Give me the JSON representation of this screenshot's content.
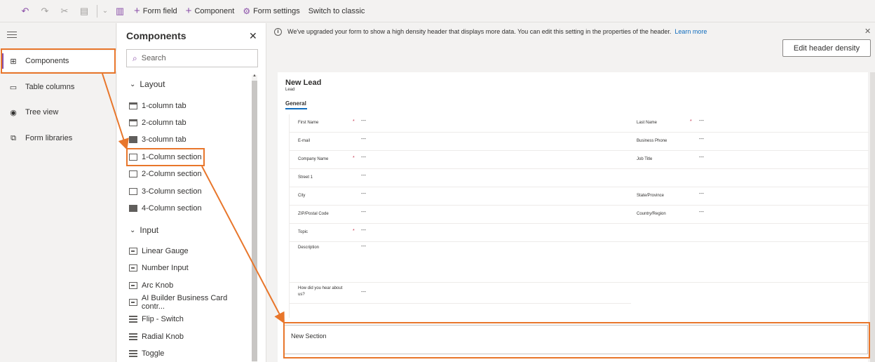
{
  "toolbar": {
    "undo_icon": "undo-icon",
    "redo_icon": "redo-icon",
    "cut_icon": "cut-icon",
    "paste_icon": "paste-icon",
    "delete_icon": "delete-icon",
    "form_field": "Form field",
    "component": "Component",
    "form_settings": "Form settings",
    "switch_classic": "Switch to classic"
  },
  "leftnav": {
    "items": [
      {
        "label": "Components",
        "icon": "components-icon"
      },
      {
        "label": "Table columns",
        "icon": "table-columns-icon"
      },
      {
        "label": "Tree view",
        "icon": "tree-view-icon"
      },
      {
        "label": "Form libraries",
        "icon": "form-libraries-icon"
      }
    ]
  },
  "components_panel": {
    "title": "Components",
    "search_placeholder": "Search",
    "groups": [
      {
        "name": "Layout",
        "items": [
          "1-column tab",
          "2-column tab",
          "3-column tab",
          "1-Column section",
          "2-Column section",
          "3-Column section",
          "4-Column section"
        ]
      },
      {
        "name": "Input",
        "items": [
          "Linear Gauge",
          "Number Input",
          "Arc Knob",
          "AI Builder Business Card contr...",
          "Flip - Switch",
          "Radial Knob",
          "Toggle"
        ]
      }
    ]
  },
  "banner": {
    "text": "We've upgraded your form to show a high density header that displays more data. You can edit this setting in the properties of the header.",
    "link": "Learn more",
    "edit_button": "Edit header density"
  },
  "form": {
    "title": "New Lead",
    "subtitle": "Lead",
    "tab": "General",
    "placeholder": "---",
    "left_fields": [
      {
        "label": "First Name",
        "required": true
      },
      {
        "label": "E-mail",
        "required": false
      },
      {
        "label": "Company Name",
        "required": true
      },
      {
        "label": "Street 1",
        "required": false
      },
      {
        "label": "City",
        "required": false
      },
      {
        "label": "ZIP/Postal Code",
        "required": false
      },
      {
        "label": "Topic",
        "required": true
      },
      {
        "label": "Description",
        "required": false
      },
      {
        "label": "How did you hear about us?",
        "required": false
      }
    ],
    "right_fields": [
      {
        "label": "Last Name",
        "required": true
      },
      {
        "label": "Business Phone",
        "required": false
      },
      {
        "label": "Job Title",
        "required": false
      },
      {
        "label": "State/Province",
        "required": false
      },
      {
        "label": "Country/Region",
        "required": false
      }
    ],
    "required_mark": "*",
    "new_section": "New Section"
  },
  "colors": {
    "accent": "#8a4fa8",
    "highlight": "#e8762b",
    "link": "#0f6cbd"
  }
}
